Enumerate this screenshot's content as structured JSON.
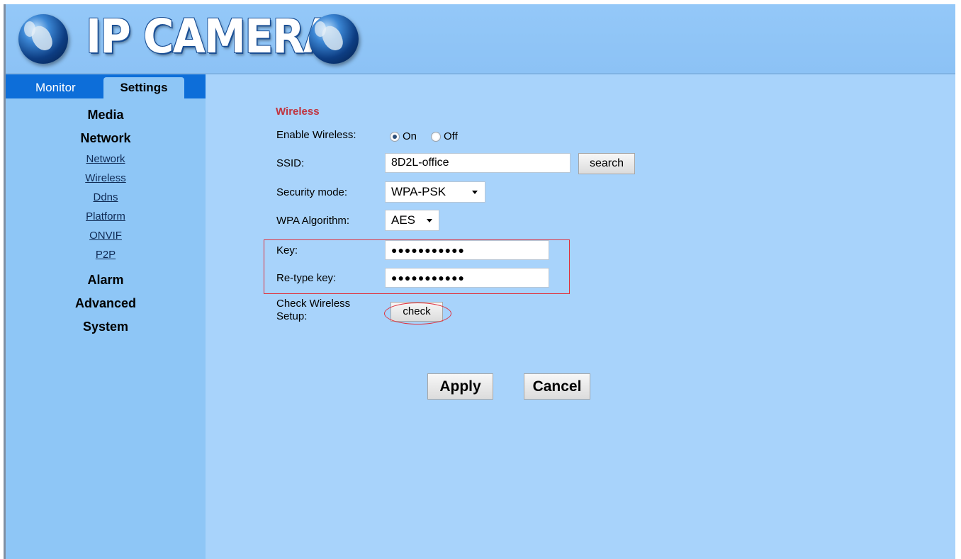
{
  "header": {
    "logo_text": "IP CAMERA",
    "left_icon": "globe-icon",
    "right_icon": "globe-icon"
  },
  "tabs": {
    "monitor": "Monitor",
    "settings": "Settings"
  },
  "sidebar": {
    "media": "Media",
    "network": "Network",
    "network_items": [
      "Network",
      "Wireless",
      "Ddns",
      "Platform",
      "ONVIF",
      "P2P"
    ],
    "alarm": "Alarm",
    "advanced": "Advanced",
    "system": "System"
  },
  "wireless": {
    "title": "Wireless",
    "enable_label": "Enable Wireless:",
    "enable_on": "On",
    "enable_off": "Off",
    "enable_selected": "On",
    "ssid_label": "SSID:",
    "ssid_value": "8D2L-office",
    "search_button": "search",
    "security_label": "Security mode:",
    "security_value": "WPA-PSK",
    "algorithm_label": "WPA Algorithm:",
    "algorithm_value": "AES",
    "key_label": "Key:",
    "key_value": "●●●●●●●●●●●",
    "retype_label": "Re-type key:",
    "retype_value": "●●●●●●●●●●●",
    "check_label_line1": "Check Wireless",
    "check_label_line2": "Setup:",
    "check_button": "check"
  },
  "actions": {
    "apply": "Apply",
    "cancel": "Cancel"
  },
  "colors": {
    "background": "#a8d3fb",
    "sidebar": "#8ec6f6",
    "tabbar": "#0d6ed9",
    "section_title": "#c0343f",
    "highlight": "#e0313d"
  }
}
